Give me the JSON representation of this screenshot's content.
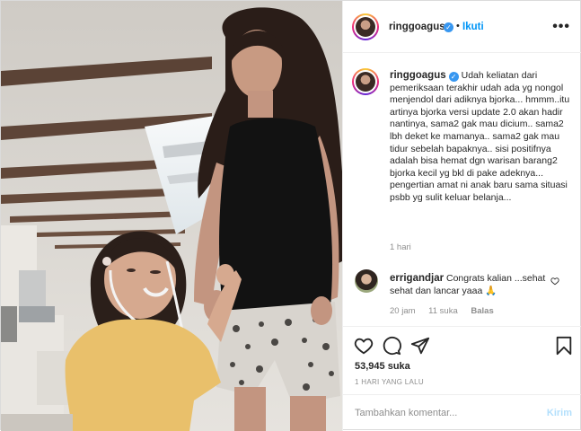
{
  "post": {
    "username": "ringgoagus",
    "follow_label": "Ikuti",
    "separator": "•",
    "verified_glyph": "✓",
    "more_glyph": "•••",
    "caption": "Udah keliatan dari pemeriksaan terakhir udah ada yg nongol menjendol dari adiknya bjorka... hmmm..itu artinya bjorka versi update 2.0 akan hadir nantinya, sama2 gak mau dicium.. sama2 lbh deket ke mamanya.. sama2 gak mau tidur sebelah bapaknya.. sisi positifnya adalah bisa hemat dgn warisan barang2 bjorka kecil yg bkl di pake adeknya... pengertian amat ni anak baru sama situasi psbb yg sulit keluar belanja...",
    "caption_time": "1 hari"
  },
  "comments": [
    {
      "username": "errigandjar",
      "text": "Congrats kalian ...sehat sehat dan lancar yaaa 🙏",
      "time": "20 jam",
      "likes": "11 suka",
      "reply_label": "Balas"
    }
  ],
  "actions": {
    "likes": "53,945 suka",
    "date": "1 HARI YANG LALU",
    "icons": [
      "heart-icon",
      "comment-icon",
      "share-icon",
      "bookmark-icon"
    ]
  },
  "composer": {
    "placeholder": "Tambahkan komentar...",
    "post_label": "Kirim"
  },
  "colors": {
    "link_blue": "#0095f6",
    "verified_blue": "#3897f0",
    "muted": "#8e8e8e",
    "post_disabled": "#b2dffc"
  }
}
